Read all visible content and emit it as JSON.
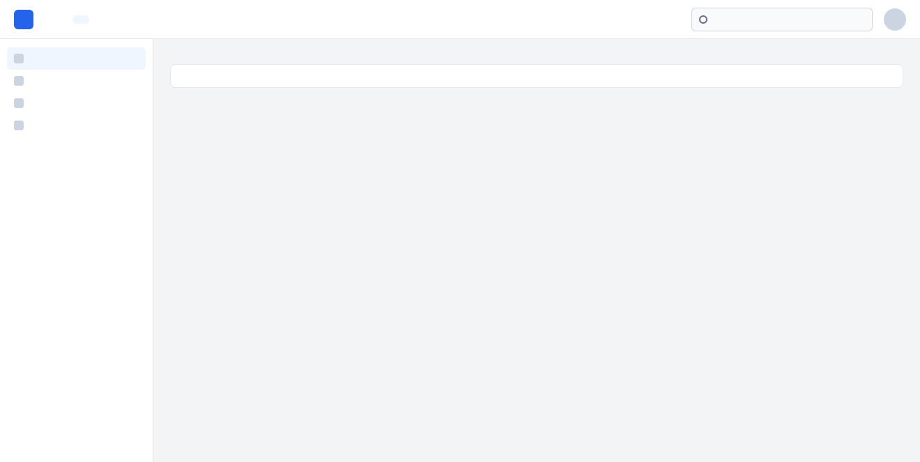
{
  "app": {
    "title": ""
  },
  "nav": {
    "tabs": [
      {
        "label": ""
      },
      {
        "label": ""
      },
      {
        "label": ""
      }
    ]
  },
  "search": {
    "placeholder": ""
  },
  "sidebar": {
    "items": [
      {
        "label": ""
      },
      {
        "label": ""
      },
      {
        "label": ""
      },
      {
        "label": ""
      }
    ]
  },
  "main": {
    "title": "",
    "body": ""
  }
}
